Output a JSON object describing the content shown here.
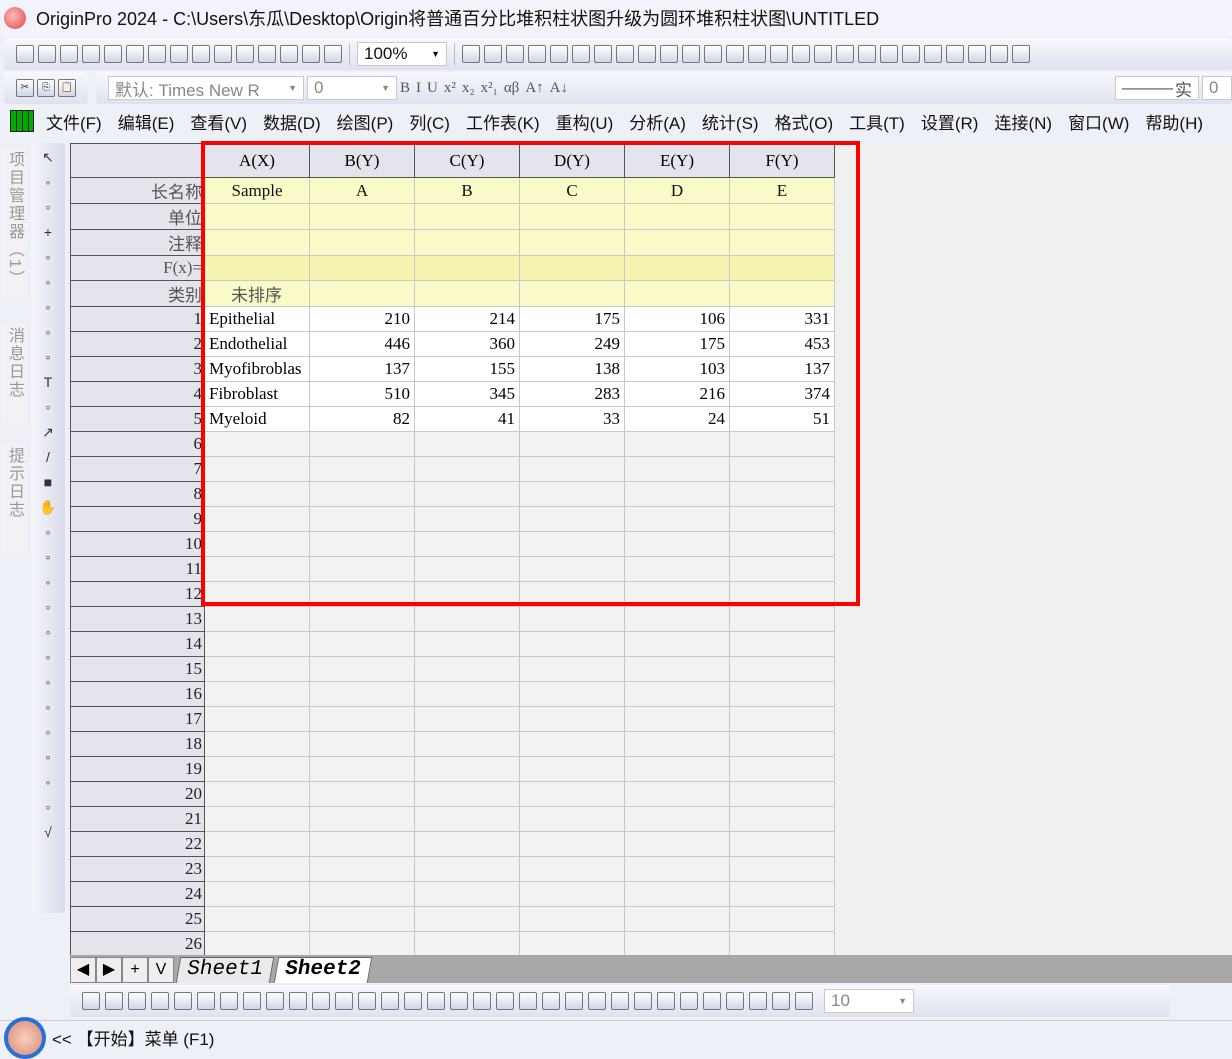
{
  "title": "OriginPro 2024 - C:\\Users\\东瓜\\Desktop\\Origin将普通百分比堆积柱状图升级为圆环堆积柱状图\\UNTITLED",
  "toolbar1": {
    "icons": [
      "new-project",
      "new-folder",
      "new-workbook",
      "new-graph",
      "new-matrix",
      "function-plot",
      "import",
      "open-book",
      "batch",
      "template",
      "open",
      "cloud",
      "save",
      "save-as",
      "run"
    ],
    "zoom": "100%",
    "icons2": [
      "print",
      "presentation",
      "layout",
      "notes",
      "split",
      "pane",
      "hierarchy",
      "find",
      "inspect",
      "table",
      "code",
      "add-column",
      "console",
      "sum",
      "stats",
      "sort",
      "num",
      "bar",
      "column",
      "peak",
      "filter",
      "filter-clear",
      "filter-reset",
      "wave",
      "close",
      "y-axis"
    ]
  },
  "toolbar2": {
    "font": "默认: Times New R",
    "size": "0",
    "format_buttons": [
      "B",
      "I",
      "U",
      "x²",
      "x₂",
      "x²₁",
      "αβ",
      "A↑",
      "A↓"
    ],
    "line_style": "实",
    "line_width": "0"
  },
  "menu": [
    "文件(F)",
    "编辑(E)",
    "查看(V)",
    "数据(D)",
    "绘图(P)",
    "列(C)",
    "工作表(K)",
    "重构(U)",
    "分析(A)",
    "统计(S)",
    "格式(O)",
    "工具(T)",
    "设置(R)",
    "连接(N)",
    "窗口(W)",
    "帮助(H)"
  ],
  "side_tabs": [
    "项目管理器（1）",
    "消息日志",
    "提示日志"
  ],
  "tools": [
    "pointer",
    "zoom-in",
    "zoom-out",
    "crosshair",
    "data-reader",
    "screen-reader",
    "mask",
    "region",
    "scatter",
    "text",
    "annotation",
    "arrow",
    "line",
    "rectangle",
    "hand",
    "formula",
    "graph",
    "insert",
    "copy",
    "list",
    "circle",
    "move",
    "chart",
    "person",
    "grid",
    "import-data",
    "table",
    "sqrt"
  ],
  "worksheet": {
    "columns": [
      "A(X)",
      "B(Y)",
      "C(Y)",
      "D(Y)",
      "E(Y)",
      "F(Y)"
    ],
    "meta_rows": [
      {
        "label": "长名称",
        "values": [
          "Sample",
          "A",
          "B",
          "C",
          "D",
          "E"
        ]
      },
      {
        "label": "单位",
        "values": [
          "",
          "",
          "",
          "",
          "",
          ""
        ]
      },
      {
        "label": "注释",
        "values": [
          "",
          "",
          "",
          "",
          "",
          ""
        ]
      },
      {
        "label": "F(x)=",
        "values": [
          "",
          "",
          "",
          "",
          "",
          ""
        ]
      },
      {
        "label": "类别",
        "values": [
          "未排序",
          "",
          "",
          "",
          "",
          ""
        ]
      }
    ],
    "rows": [
      [
        "Epithelial",
        "210",
        "214",
        "175",
        "106",
        "331"
      ],
      [
        "Endothelial",
        "446",
        "360",
        "249",
        "175",
        "453"
      ],
      [
        "Myofibroblas",
        "137",
        "155",
        "138",
        "103",
        "137"
      ],
      [
        "Fibroblast",
        "510",
        "345",
        "283",
        "216",
        "374"
      ],
      [
        "Myeloid",
        "82",
        "41",
        "33",
        "24",
        "51"
      ]
    ],
    "total_rows": 26
  },
  "sheet_nav": [
    "◀",
    "▶",
    "+",
    "V"
  ],
  "sheets": [
    "Sheet1",
    "Sheet2"
  ],
  "active_sheet": "Sheet2",
  "bottom_toolbar": {
    "icons": [
      "line",
      "scatter",
      "line-symbol",
      "column",
      "grid-plot",
      "box",
      "area",
      "polar",
      "candlestick",
      "template",
      "3d-bar",
      "3d-surface",
      "3d-scatter",
      "heatmap",
      "contour",
      "image",
      "stack1",
      "stack2",
      "face",
      "arrange1",
      "arrange2",
      "arrange3",
      "align",
      "layer1",
      "layer2",
      "layer3",
      "layer4",
      "layer5",
      "layer6",
      "layer7",
      "layer8",
      "layer9"
    ],
    "size": "10"
  },
  "status": "<<  【开始】菜单 (F1)",
  "highlight_color": "#ff0000"
}
